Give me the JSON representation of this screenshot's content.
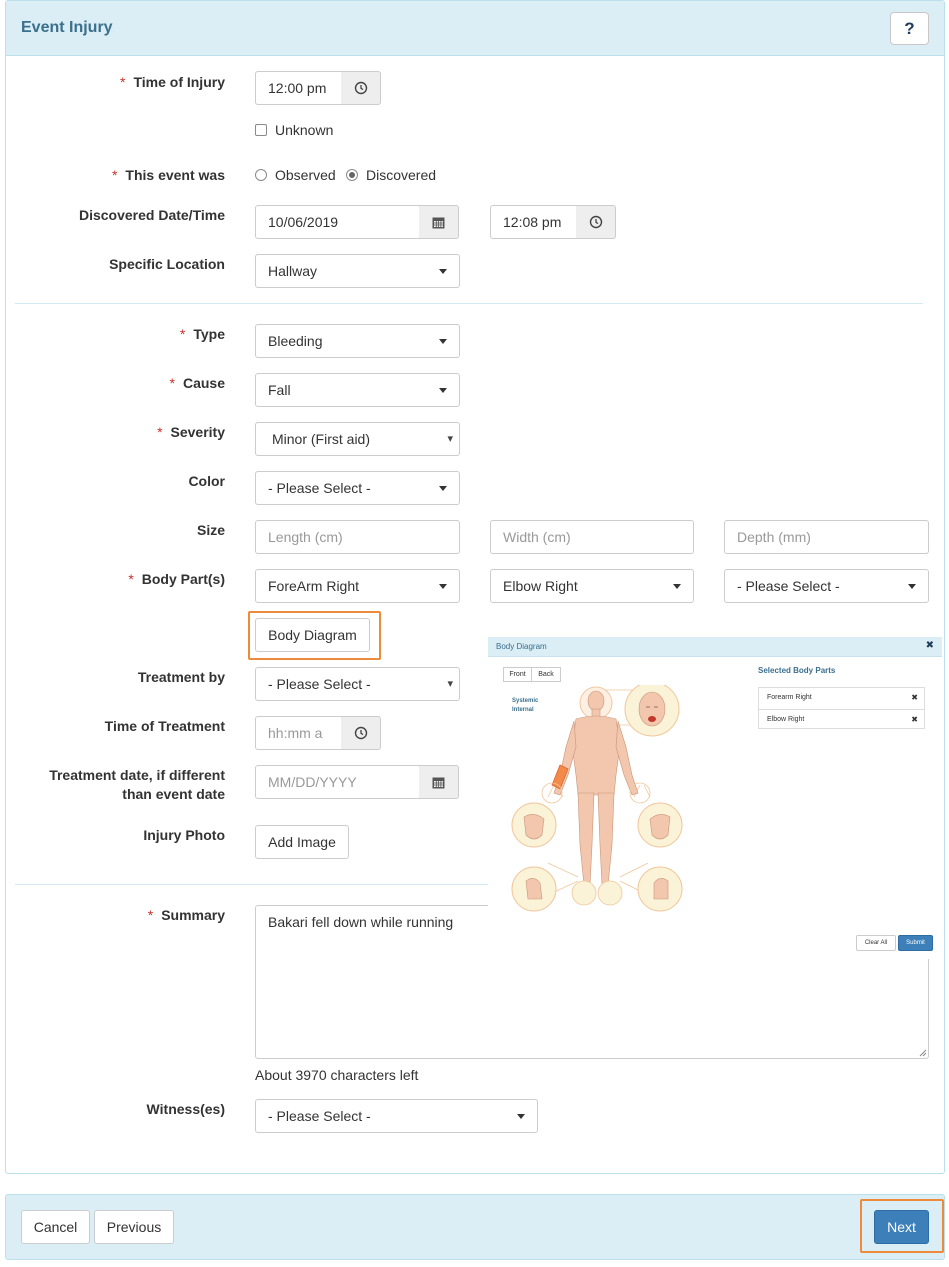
{
  "header": {
    "title": "Event Injury",
    "help_label": "?"
  },
  "time_of_injury": {
    "label": "Time of Injury",
    "value": "12:00 pm",
    "unknown_label": "Unknown",
    "unknown_checked": false
  },
  "event_was": {
    "label": "This event was",
    "options": [
      "Observed",
      "Discovered"
    ],
    "selected": "Discovered"
  },
  "discovered": {
    "label": "Discovered Date/Time",
    "date": "10/06/2019",
    "time": "12:08 pm"
  },
  "specific_location": {
    "label": "Specific Location",
    "value": "Hallway"
  },
  "type": {
    "label": "Type",
    "value": "Bleeding"
  },
  "cause": {
    "label": "Cause",
    "value": "Fall"
  },
  "severity": {
    "label": "Severity",
    "value": "Minor (First aid)"
  },
  "color": {
    "label": "Color",
    "value": "- Please Select -"
  },
  "size": {
    "label": "Size",
    "length_placeholder": "Length (cm)",
    "width_placeholder": "Width (cm)",
    "depth_placeholder": "Depth (mm)"
  },
  "body_parts": {
    "label": "Body Part(s)",
    "values": [
      "ForeArm Right",
      "Elbow Right",
      "- Please Select -"
    ],
    "diagram_button": "Body Diagram"
  },
  "treatment_by": {
    "label": "Treatment by",
    "value": "- Please Select -"
  },
  "time_of_treatment": {
    "label": "Time of Treatment",
    "placeholder": "hh:mm a"
  },
  "treatment_date": {
    "label_line1": "Treatment date, if different",
    "label_line2": "than event date",
    "placeholder": "MM/DD/YYYY"
  },
  "injury_photo": {
    "label": "Injury Photo",
    "button": "Add Image"
  },
  "summary": {
    "label": "Summary",
    "value": "Bakari fell down while running",
    "chars_left": "About 3970 characters left"
  },
  "witnesses": {
    "label": "Witness(es)",
    "value": "- Please Select -"
  },
  "body_diagram": {
    "title": "Body Diagram",
    "tabs": [
      "Front",
      "Back"
    ],
    "toggles": [
      "Systemic",
      "Internal"
    ],
    "selected_heading": "Selected Body Parts",
    "selected": [
      "Forearm Right",
      "Elbow Right"
    ],
    "clear_label": "Clear All",
    "submit_label": "Submit"
  },
  "footer": {
    "cancel": "Cancel",
    "previous": "Previous",
    "next": "Next"
  },
  "colors": {
    "accent": "#3d7fb8",
    "header_bg": "#dbeef5",
    "highlight": "#ee8a3c",
    "required": "#c9302c",
    "skin": "#f2c7ad"
  }
}
